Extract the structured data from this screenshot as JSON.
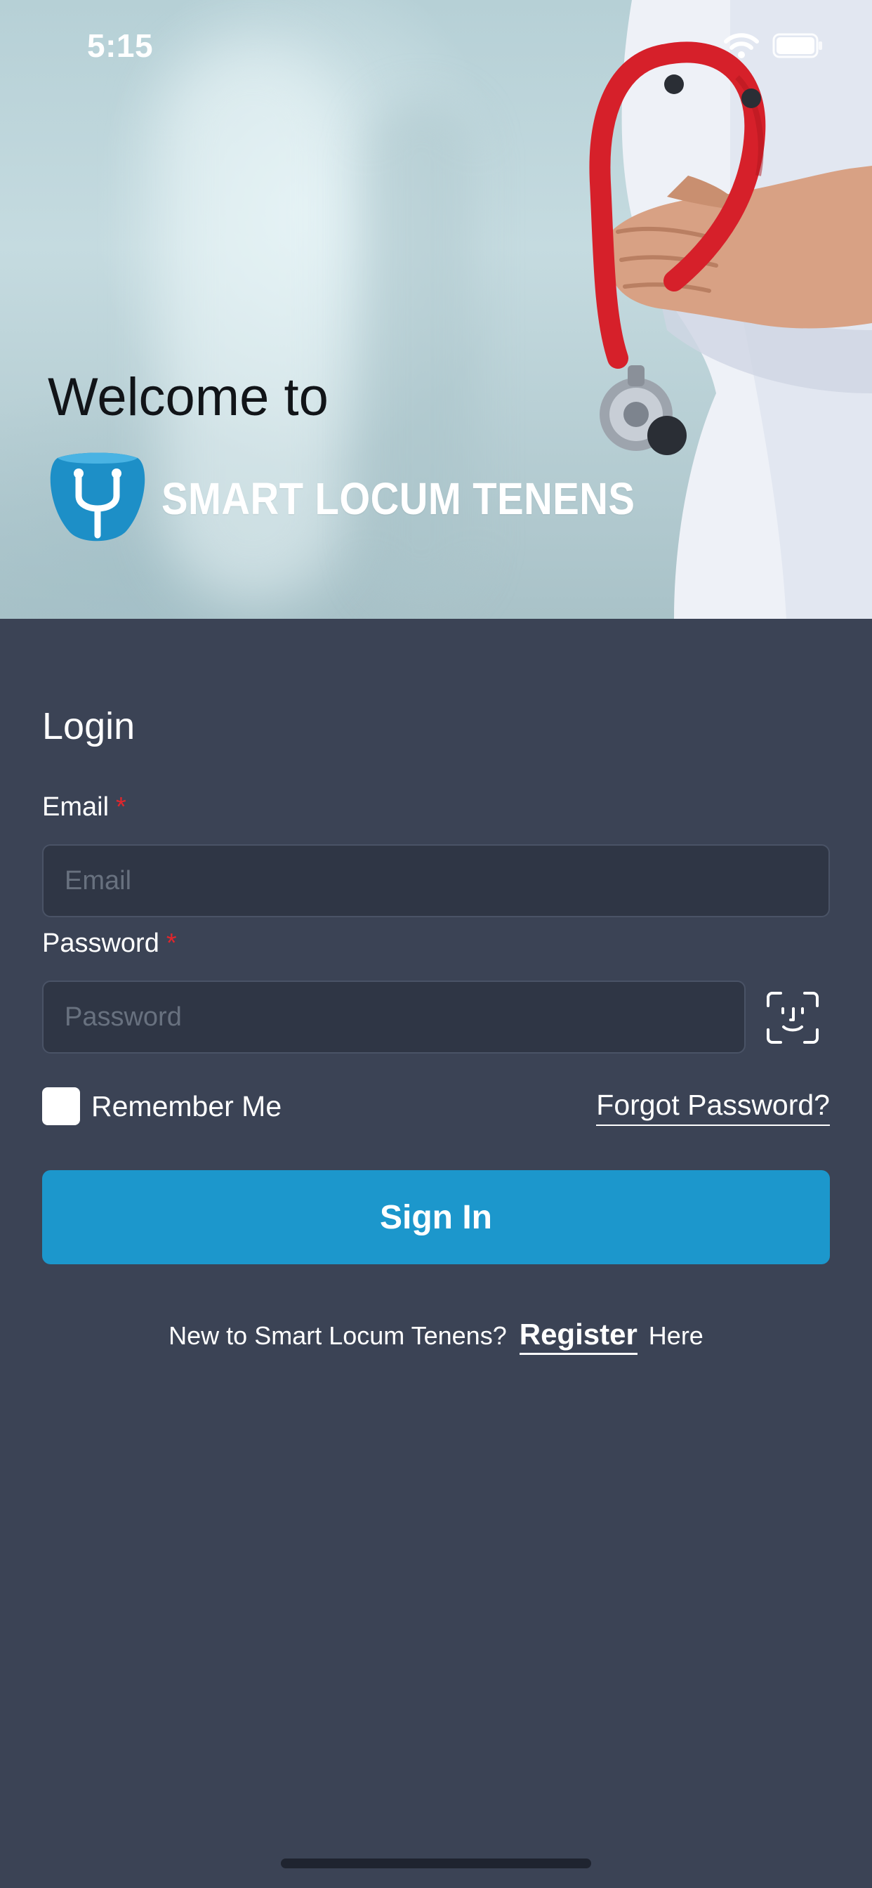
{
  "status_bar": {
    "time": "5:15",
    "icons": [
      "wifi-icon",
      "battery-icon"
    ]
  },
  "hero": {
    "welcome": "Welcome to",
    "brand_name": "SMART LOCUM TENENS",
    "logo_icon": "stethoscope-shield-logo"
  },
  "form": {
    "title": "Login",
    "email": {
      "label": "Email",
      "required_mark": "*",
      "value": "",
      "placeholder": "Email"
    },
    "password": {
      "label": "Password",
      "required_mark": "*",
      "value": "",
      "placeholder": "Password"
    },
    "face_id_icon": "face-id-icon",
    "remember_me": {
      "label": "Remember Me",
      "checked": false
    },
    "forgot_password": "Forgot Password?",
    "sign_in": "Sign In",
    "register": {
      "prefix": "New to Smart Locum Tenens?",
      "link": "Register",
      "suffix": "Here"
    }
  },
  "colors": {
    "background": "#3b4355",
    "input_background": "#2f3645",
    "primary_button": "#1c97cc",
    "required": "#e0262c",
    "logo_blue": "#1d8fc7"
  }
}
